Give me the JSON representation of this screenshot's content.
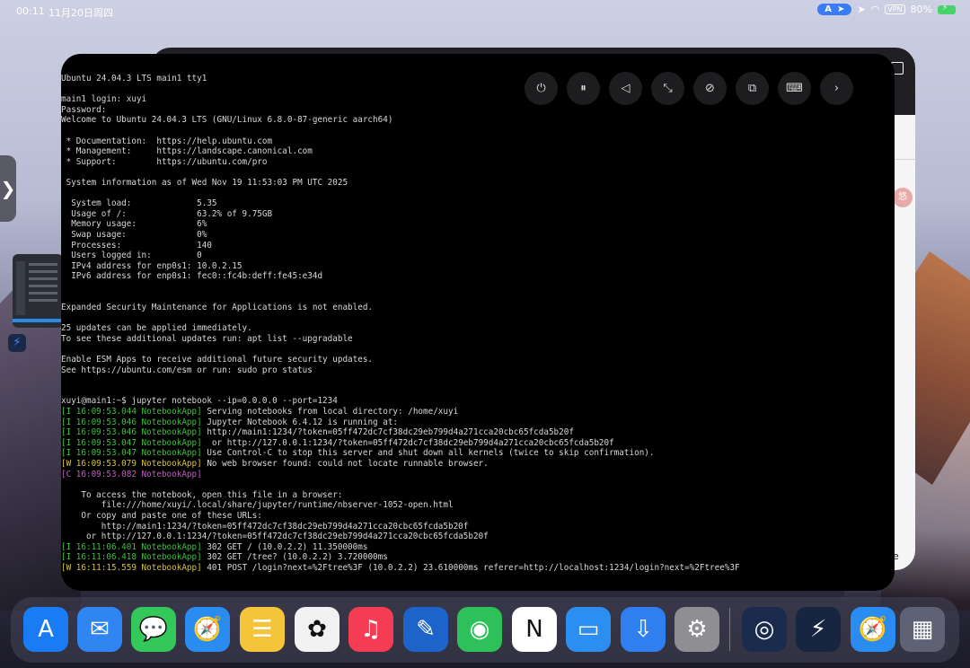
{
  "status_bar": {
    "time": "00:11",
    "date": "11月20日周四",
    "nav_pill": "A",
    "vpn": "VPN",
    "battery": "80%"
  },
  "bg_window": {
    "avatar_text": "悠",
    "close_glyph": "×",
    "edge_letter": "e"
  },
  "side_handle": {
    "glyph": "❯"
  },
  "terminal": {
    "controls": [
      {
        "name": "power-icon",
        "glyph": "⏻"
      },
      {
        "name": "pause-icon",
        "glyph": "⏸"
      },
      {
        "name": "back-icon",
        "glyph": "◁"
      },
      {
        "name": "shrink-icon",
        "glyph": "⤡"
      },
      {
        "name": "disable-icon",
        "glyph": "⊘"
      },
      {
        "name": "windows-icon",
        "glyph": "⧉"
      },
      {
        "name": "keyboard-icon",
        "glyph": "⌨"
      },
      {
        "name": "next-icon",
        "glyph": "›"
      }
    ],
    "lines": [
      [
        {
          "t": "Ubuntu 24.04.3 LTS main1 tty1"
        }
      ],
      [
        {
          "t": ""
        }
      ],
      [
        {
          "t": "main1 login: xuyi"
        }
      ],
      [
        {
          "t": "Password:"
        }
      ],
      [
        {
          "t": "Welcome to Ubuntu 24.04.3 LTS (GNU/Linux 6.8.0-87-generic aarch64)"
        }
      ],
      [
        {
          "t": ""
        }
      ],
      [
        {
          "t": " * Documentation:  https://help.ubuntu.com"
        }
      ],
      [
        {
          "t": " * Management:     https://landscape.canonical.com"
        }
      ],
      [
        {
          "t": " * Support:        https://ubuntu.com/pro"
        }
      ],
      [
        {
          "t": ""
        }
      ],
      [
        {
          "t": " System information as of Wed Nov 19 11:53:03 PM UTC 2025"
        }
      ],
      [
        {
          "t": ""
        }
      ],
      [
        {
          "t": "  System load:             5.35"
        }
      ],
      [
        {
          "t": "  Usage of /:              63.2% of 9.75GB"
        }
      ],
      [
        {
          "t": "  Memory usage:            6%"
        }
      ],
      [
        {
          "t": "  Swap usage:              0%"
        }
      ],
      [
        {
          "t": "  Processes:               140"
        }
      ],
      [
        {
          "t": "  Users logged in:         0"
        }
      ],
      [
        {
          "t": "  IPv4 address for enp0s1: 10.0.2.15"
        }
      ],
      [
        {
          "t": "  IPv6 address for enp0s1: fec0::fc4b:deff:fe45:e34d"
        }
      ],
      [
        {
          "t": ""
        }
      ],
      [
        {
          "t": ""
        }
      ],
      [
        {
          "t": "Expanded Security Maintenance for Applications is not enabled."
        }
      ],
      [
        {
          "t": ""
        }
      ],
      [
        {
          "t": "25 updates can be applied immediately."
        }
      ],
      [
        {
          "t": "To see these additional updates run: apt list --upgradable"
        }
      ],
      [
        {
          "t": ""
        }
      ],
      [
        {
          "t": "Enable ESM Apps to receive additional future security updates."
        }
      ],
      [
        {
          "t": "See https://ubuntu.com/esm or run: sudo pro status"
        }
      ],
      [
        {
          "t": ""
        }
      ],
      [
        {
          "t": ""
        }
      ],
      [
        {
          "t": "xuyi@main1:~$ jupyter notebook --ip=0.0.0.0 --port=1234"
        }
      ],
      [
        {
          "t": "[I 16:09:53.044 NotebookApp]",
          "c": "g"
        },
        {
          "t": " Serving notebooks from local directory: /home/xuyi"
        }
      ],
      [
        {
          "t": "[I 16:09:53.046 NotebookApp]",
          "c": "g"
        },
        {
          "t": " Jupyter Notebook 6.4.12 is running at:"
        }
      ],
      [
        {
          "t": "[I 16:09:53.046 NotebookApp]",
          "c": "g"
        },
        {
          "t": " http://main1:1234/?token=05ff472dc7cf38dc29eb799d4a271cca20cbc65fcda5b20f"
        }
      ],
      [
        {
          "t": "[I 16:09:53.047 NotebookApp]",
          "c": "g"
        },
        {
          "t": "  or http://127.0.0.1:1234/?token=05ff472dc7cf38dc29eb799d4a271cca20cbc65fcda5b20f"
        }
      ],
      [
        {
          "t": "[I 16:09:53.047 NotebookApp]",
          "c": "g"
        },
        {
          "t": " Use Control-C to stop this server and shut down all kernels (twice to skip confirmation)."
        }
      ],
      [
        {
          "t": "[W 16:09:53.079 NotebookApp]",
          "c": "y"
        },
        {
          "t": " No web browser found: could not locate runnable browser."
        }
      ],
      [
        {
          "t": "[C 16:09:53.082 NotebookApp]",
          "c": "m"
        }
      ],
      [
        {
          "t": ""
        }
      ],
      [
        {
          "t": "    To access the notebook, open this file in a browser:"
        }
      ],
      [
        {
          "t": "        file:///home/xuyi/.local/share/jupyter/runtime/nbserver-1052-open.html"
        }
      ],
      [
        {
          "t": "    Or copy and paste one of these URLs:"
        }
      ],
      [
        {
          "t": "        http://main1:1234/?token=05ff472dc7cf38dc29eb799d4a271cca20cbc65fcda5b20f"
        }
      ],
      [
        {
          "t": "     or http://127.0.0.1:1234/?token=05ff472dc7cf38dc29eb799d4a271cca20cbc65fcda5b20f"
        }
      ],
      [
        {
          "t": "[I 16:11:06.401 NotebookApp]",
          "c": "g"
        },
        {
          "t": " 302 GET / (10.0.2.2) 11.350000ms"
        }
      ],
      [
        {
          "t": "[I 16:11:06.418 NotebookApp]",
          "c": "g"
        },
        {
          "t": " 302 GET /tree? (10.0.2.2) 3.720000ms"
        }
      ],
      [
        {
          "t": "[W 16:11:15.559 NotebookApp]",
          "c": "y"
        },
        {
          "t": " 401 POST /login?next=%2Ftree%3F (10.0.2.2) 23.610000ms referer=http://localhost:1234/login?next=%2Ftree%3F"
        }
      ]
    ]
  },
  "dock": [
    {
      "name": "app-store-icon",
      "glyph": "A",
      "bg": "#1a7cf5"
    },
    {
      "name": "mail-icon",
      "glyph": "✉",
      "bg": "#2f86f3"
    },
    {
      "name": "messages-icon",
      "glyph": "💬",
      "bg": "#34c759"
    },
    {
      "name": "safari-icon",
      "glyph": "🧭",
      "bg": "#2a8cf0"
    },
    {
      "name": "notes-icon",
      "glyph": "☰",
      "bg": "#f4c53a"
    },
    {
      "name": "photos-icon",
      "glyph": "✿",
      "bg": "#f1f1f1"
    },
    {
      "name": "music-icon",
      "glyph": "♫",
      "bg": "#f43c52"
    },
    {
      "name": "freeform-icon",
      "glyph": "✎",
      "bg": "#1e63c9"
    },
    {
      "name": "wechat-icon",
      "glyph": "◉",
      "bg": "#2ec15a"
    },
    {
      "name": "notion-icon",
      "glyph": "N",
      "bg": "#ffffff"
    },
    {
      "name": "files-icon",
      "glyph": "▭",
      "bg": "#2d8ef2"
    },
    {
      "name": "download-icon",
      "glyph": "⇩",
      "bg": "#2f7ff0"
    },
    {
      "name": "settings-icon",
      "glyph": "⚙",
      "bg": "#8e8e93"
    },
    {
      "name": "remote-icon",
      "glyph": "◎",
      "bg": "#1a2b4e"
    },
    {
      "name": "bolt-app-icon",
      "glyph": "⚡",
      "bg": "#162641"
    },
    {
      "name": "safari-2-icon",
      "glyph": "🧭",
      "bg": "#2a8cf0"
    },
    {
      "name": "app-library-icon",
      "glyph": "▦",
      "bg": "#5f6275"
    }
  ]
}
